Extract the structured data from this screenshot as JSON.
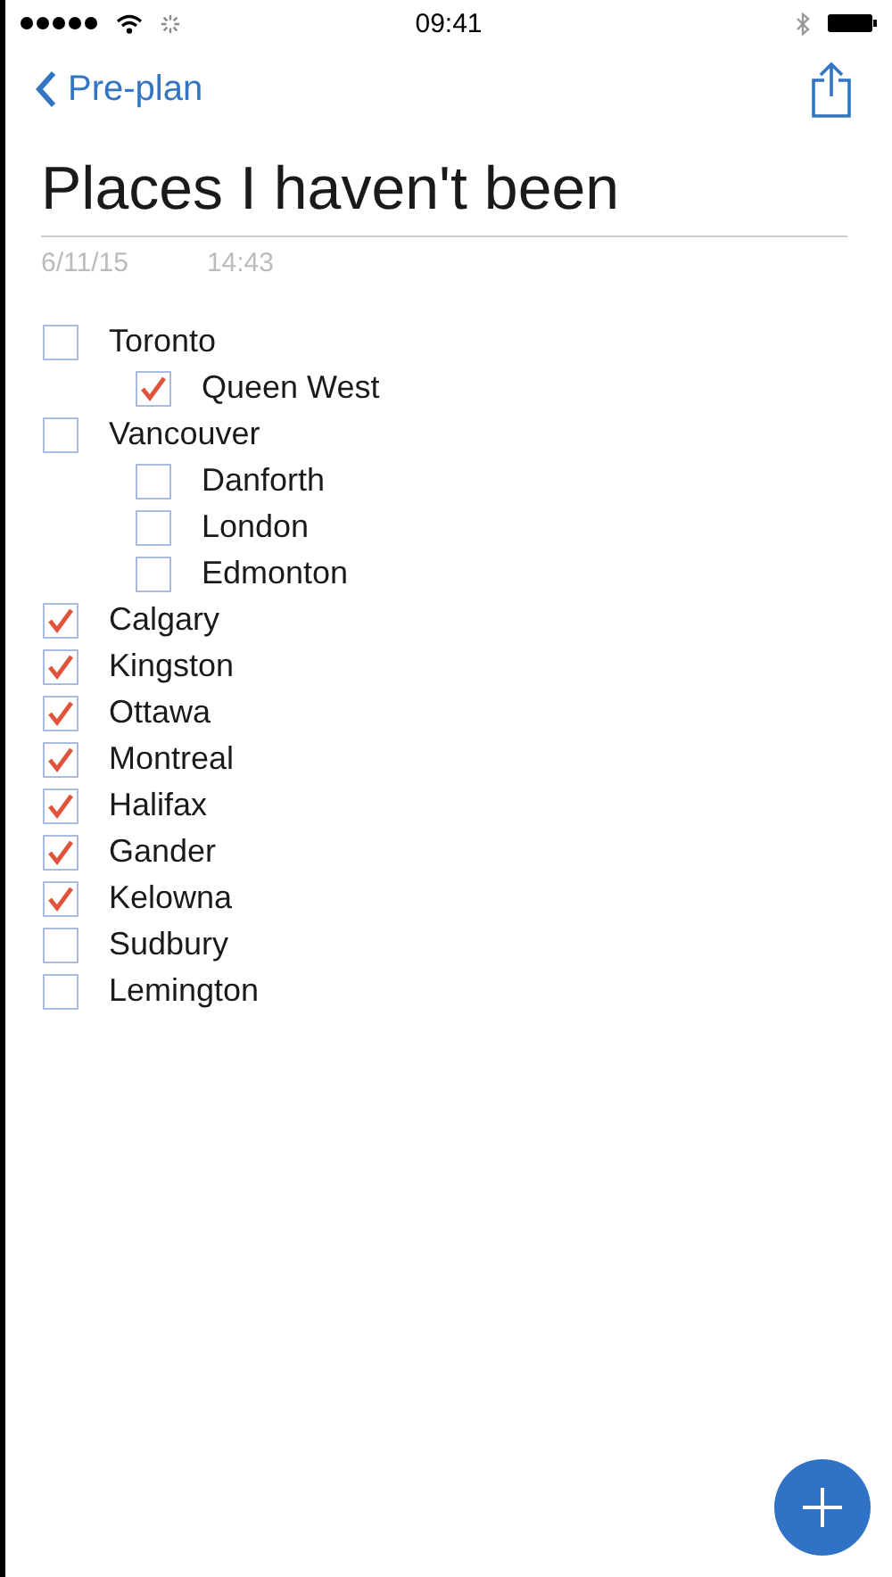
{
  "status_bar": {
    "time": "09:41"
  },
  "nav": {
    "back": "Pre-plan"
  },
  "note": {
    "title": "Places I haven't been",
    "date": "6/11/15",
    "time": "14:43"
  },
  "items": [
    {
      "label": "Toronto",
      "checked": false,
      "children": [
        {
          "label": "Queen West",
          "checked": true
        }
      ]
    },
    {
      "label": "Vancouver",
      "checked": false,
      "children": [
        {
          "label": "Danforth",
          "checked": false
        },
        {
          "label": "London",
          "checked": false
        },
        {
          "label": "Edmonton",
          "checked": false
        }
      ]
    },
    {
      "label": "Calgary",
      "checked": true
    },
    {
      "label": "Kingston",
      "checked": true
    },
    {
      "label": "Ottawa",
      "checked": true
    },
    {
      "label": "Montreal",
      "checked": true
    },
    {
      "label": "Halifax",
      "checked": true
    },
    {
      "label": "Gander",
      "checked": true
    },
    {
      "label": "Kelowna",
      "checked": true
    },
    {
      "label": "Sudbury",
      "checked": false
    },
    {
      "label": "Lemington",
      "checked": false
    }
  ]
}
